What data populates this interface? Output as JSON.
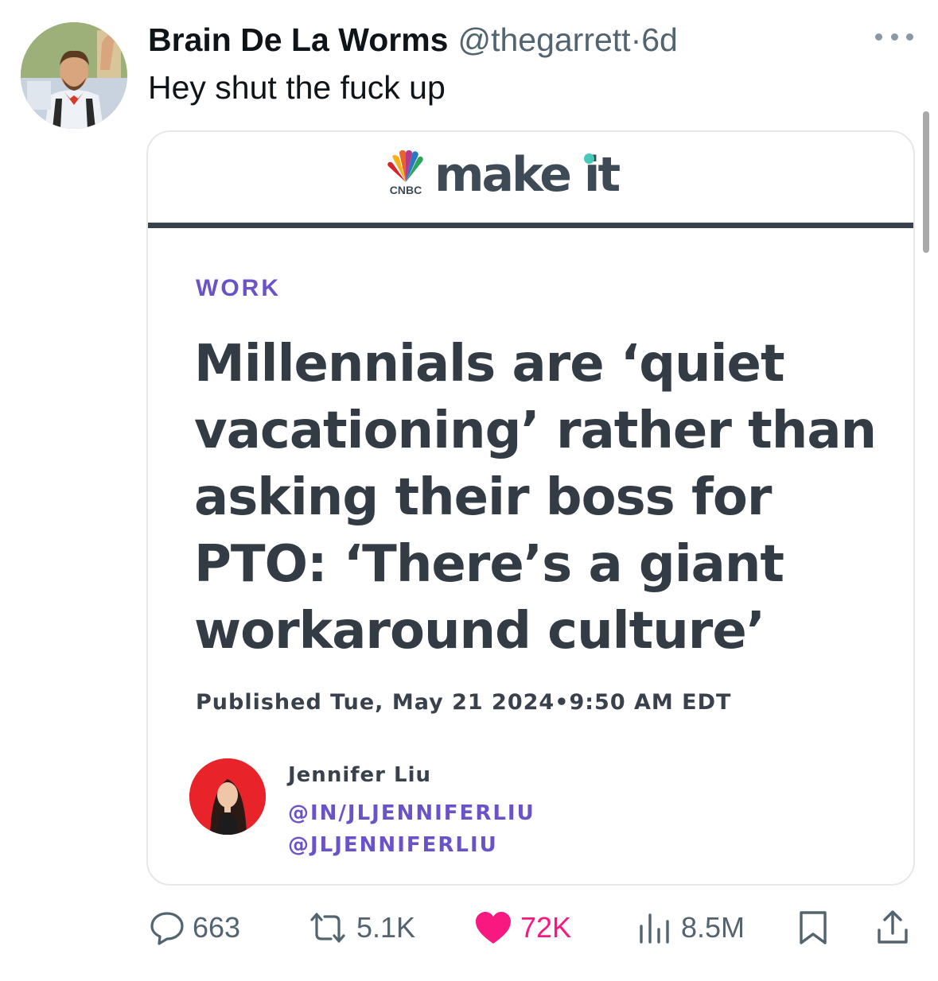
{
  "tweet": {
    "display_name": "Brain De La Worms",
    "handle": "@thegarrett",
    "separator": "·",
    "time": "6d",
    "text": "Hey shut the fuck up"
  },
  "card": {
    "brand_small": "CNBC",
    "brand_large": "make it",
    "section": "WORK",
    "headline": "Millennials are ‘quiet vacationing’ rather than asking their boss for PTO: ‘There’s a giant workaround culture’",
    "published": "Published Tue, May 21 2024•9:50 AM EDT",
    "author_name": "Jennifer Liu",
    "author_link_1": "@IN/JLJENNIFERLIU",
    "author_link_2": "@JLJENNIFERLIU"
  },
  "actions": {
    "replies": "663",
    "retweets": "5.1K",
    "likes": "72K",
    "views": "8.5M"
  },
  "colors": {
    "like": "#f91880",
    "muted": "#536471",
    "card_accent": "#6a52c9",
    "brand_dot": "#46c9b8"
  },
  "icons": [
    "more-icon",
    "reply-icon",
    "retweet-icon",
    "like-icon",
    "views-icon",
    "bookmark-icon",
    "share-icon"
  ]
}
